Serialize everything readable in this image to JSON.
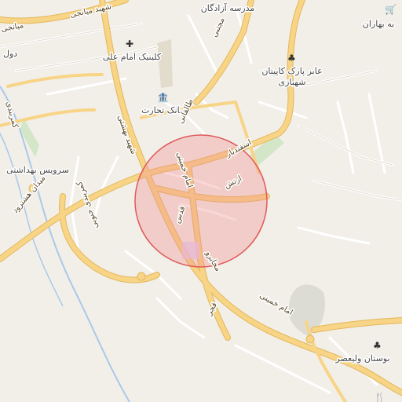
{
  "map": {
    "colors": {
      "background": "#f2efe9",
      "major_road": "#f8d487",
      "major_road_casing": "#e2b85a",
      "minor_road": "#ffffff",
      "minor_road_casing": "#d9d2c6",
      "park": "#d4e6c8",
      "river": "#a9c9e8",
      "circle_fill": "#f28c8c",
      "circle_stroke": "#e05a5a"
    },
    "labels": {
      "azadegan_school": "مدرسه آزادگان",
      "mojtaba": "مجتبی",
      "shahid_mianji": "شهید میانجی",
      "mianji_short": "میانجی",
      "imam_ali_clinic": "کلینیک امام علی",
      "tejarat_bank": "بانک تجارت",
      "taleghani": "طالقانی",
      "shahid_beheshti": "شهید بهشتی",
      "abar_park": "عابر پارک کاپیتان",
      "abar_park_2": "شهبازی",
      "health_service": "سرویس بهداشتی",
      "kamarbandi_jonubi": "کمربندی جنوبی",
      "meydan_hashtrood": "میدان هشترود",
      "esfandiar": "اسفندیار",
      "artesh": "ارتش",
      "imam_khomeini": "امام خمینی",
      "imam_khomeini_2": "امام خمینی",
      "qods": "قدس",
      "mokhabero": "مخابرو",
      "fajr": "فجر",
      "boostan_valiasr": "بوستان ولیعصر",
      "bahar": "به بهاران",
      "dol": "دول",
      "kamarbandi_short": "کمربندی"
    },
    "icons": {
      "clinic": "✚",
      "bank": "🏦",
      "park": "♣",
      "cart": "🛒",
      "restaurant": "🍴"
    }
  }
}
